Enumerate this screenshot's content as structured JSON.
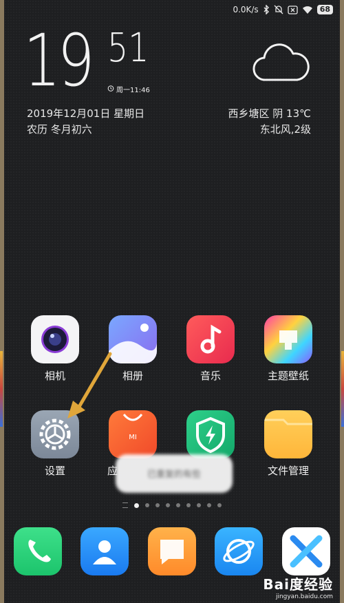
{
  "status_bar": {
    "network_speed": "0.0K/s",
    "battery": "68"
  },
  "lockscreen_clock": {
    "hours": "19",
    "minutes": "51",
    "alarm": "周一11:46"
  },
  "date": {
    "gregorian": "2019年12月01日  星期日",
    "lunar": "农历 冬月初六"
  },
  "weather": {
    "location_temp": "西乡塘区  阴  13℃",
    "wind": "东北风,2级",
    "icon": "cloud-icon"
  },
  "apps": [
    {
      "label": "相机",
      "icon": "camera-icon"
    },
    {
      "label": "相册",
      "icon": "gallery-icon"
    },
    {
      "label": "音乐",
      "icon": "music-icon"
    },
    {
      "label": "主题壁纸",
      "icon": "theme-brush-icon"
    },
    {
      "label": "设置",
      "icon": "settings-gear-icon"
    },
    {
      "label": "应",
      "icon": "mi-store-bag-icon"
    },
    {
      "label": "",
      "icon": "security-shield-icon"
    },
    {
      "label": "文件管理",
      "icon": "folder-icon"
    }
  ],
  "toast": {
    "text": "已重复的有些"
  },
  "page_indicator": {
    "count": 9,
    "active": 1
  },
  "dock": [
    {
      "icon": "phone-icon"
    },
    {
      "icon": "contacts-icon"
    },
    {
      "icon": "messages-icon"
    },
    {
      "icon": "browser-icon"
    },
    {
      "icon": "x-app-icon"
    }
  ],
  "watermark": {
    "brand": "Bai度经验",
    "url": "jingyan.baidu.com"
  },
  "colors": {
    "background": "#1e1f21",
    "arrow": "#e0a63a",
    "text": "#f0f0f0"
  }
}
